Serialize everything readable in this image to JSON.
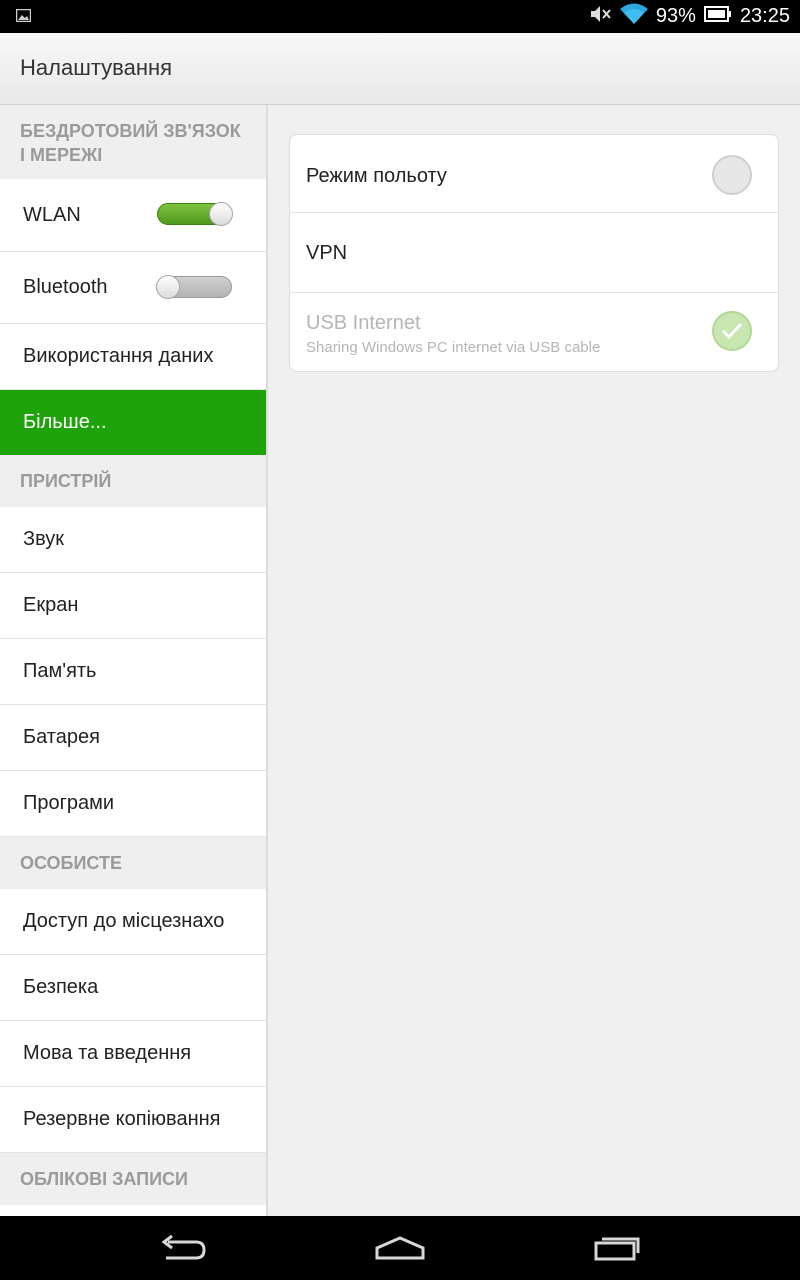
{
  "status_bar": {
    "left_icon": "image-notification-icon",
    "icons": [
      "mute-icon",
      "wifi-icon"
    ],
    "battery": "93%",
    "battery_icon": "battery-icon",
    "time": "23:25"
  },
  "action_bar": {
    "title": "Налаштування"
  },
  "sidebar": {
    "section_wireless": "БЕЗДРОТОВИЙ ЗВ'ЯЗОК І МЕРЕЖІ",
    "wlan": {
      "label": "WLAN",
      "toggle": "on"
    },
    "bluetooth": {
      "label": "Bluetooth",
      "toggle": "off"
    },
    "data_usage": "Використання даних",
    "more": "Більше...",
    "section_device": "ПРИСТРІЙ",
    "sound": "Звук",
    "display": "Екран",
    "storage": "Пам'ять",
    "battery": "Батарея",
    "apps": "Програми",
    "section_personal": "ОСОБИСТЕ",
    "location": "Доступ до місцезнахо",
    "security": "Безпека",
    "language": "Мова та введення",
    "backup": "Резервне копіювання",
    "section_accounts": "ОБЛІКОВІ ЗАПИСИ"
  },
  "detail": {
    "airplane": {
      "label": "Режим польоту",
      "checked": false
    },
    "vpn": {
      "label": "VPN"
    },
    "usb": {
      "label": "USB Internet",
      "summary": "Sharing Windows PC internet via USB cable",
      "checked": true,
      "enabled": false
    }
  },
  "colors": {
    "accent": "#1fa30b",
    "toggle_on": "#5faa25"
  },
  "nav_bar": {
    "buttons": [
      "back-icon",
      "home-icon",
      "recents-icon"
    ]
  }
}
